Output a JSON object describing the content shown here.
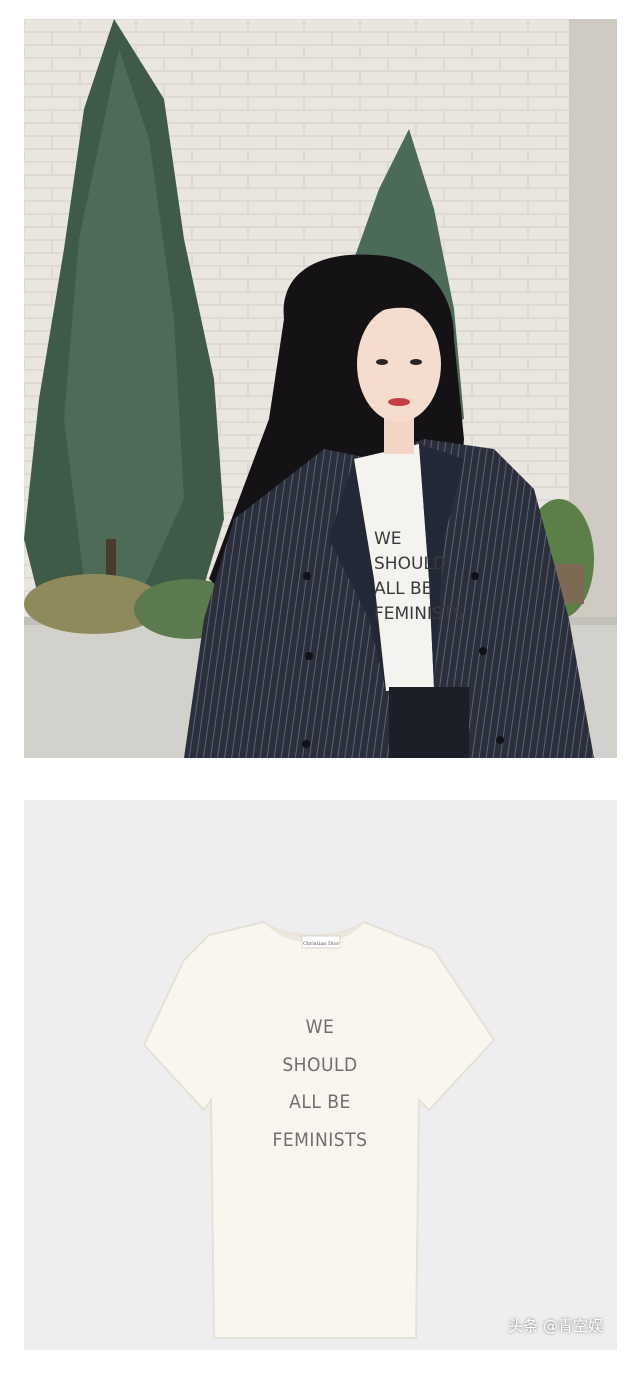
{
  "photo1": {
    "shirt_slogan": [
      "WE",
      "SHOULD",
      "ALL BE",
      "FEMINISTS"
    ],
    "colors": {
      "wall": "#dcd8d0",
      "blazer": "#2a2f3b",
      "hair": "#141214",
      "tree": "#3f5a47"
    }
  },
  "photo2": {
    "collar_label": "Christian Dior",
    "shirt_slogan": [
      "WE",
      "SHOULD",
      "ALL BE",
      "FEMINISTS"
    ],
    "colors": {
      "background": "#eeeef0",
      "shirt": "#f9f6ef",
      "print": "#6f6f72"
    }
  },
  "watermark": "头条 @青空娱"
}
